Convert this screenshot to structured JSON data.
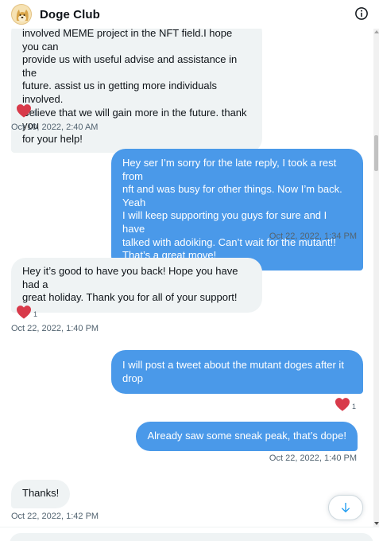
{
  "header": {
    "title": "Doge Club",
    "avatar_icon": "doge-avatar",
    "info_icon": "info-icon"
  },
  "colors": {
    "outgoing_bubble": "#4a99e9",
    "incoming_bubble": "#eff3f4",
    "heart": "#e0245e",
    "muted_text": "#536471"
  },
  "messages": [
    {
      "direction": "in",
      "lines": [
        "involved MEME project in the NFT field.I hope you can",
        "provide us with useful advise and assistance in the",
        "future. assist us in getting more individuals involved.",
        "Believe that we will gain more in the future. thank you",
        "for your help!"
      ],
      "reaction_count": "1",
      "timestamp": "Oct 10, 2022, 2:40 AM"
    },
    {
      "direction": "out",
      "lines": [
        "Hey ser I’m sorry for the late reply, I took a rest from",
        "nft and was busy for other things. Now I’m back. Yeah",
        "I will keep supporting you guys for sure and I have",
        "talked with adoiking. Can’t wait for the mutant!!",
        "That’s a great move!"
      ],
      "timestamp": "Oct 22, 2022, 1:34 PM"
    },
    {
      "direction": "in",
      "lines": [
        "Hey it’s good to have you back! Hope you have had a",
        "great holiday. Thank you for all of your support!"
      ],
      "reaction_count": "1",
      "timestamp": "Oct 22, 2022, 1:40 PM"
    },
    {
      "direction": "out",
      "lines": [
        "I will post a tweet about the mutant doges after it",
        "drop"
      ],
      "reaction_count": "1"
    },
    {
      "direction": "out",
      "lines": [
        "Already saw some sneak peak, that’s dope!"
      ],
      "timestamp": "Oct 22, 2022, 1:40 PM"
    },
    {
      "direction": "in",
      "lines": [
        "Thanks!"
      ],
      "timestamp": "Oct 22, 2022, 1:42 PM"
    }
  ],
  "scroll_to_bottom_icon": "arrow-down-icon"
}
